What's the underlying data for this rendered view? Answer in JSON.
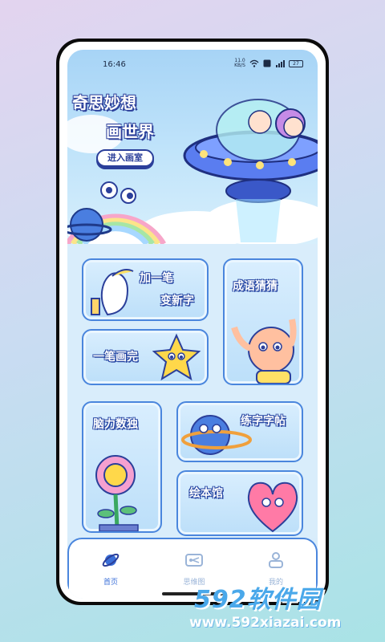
{
  "status_bar": {
    "time": "16:46",
    "speed_value": "11.0",
    "speed_unit": "KB/S",
    "battery": "27"
  },
  "hero": {
    "title_line1": "奇思妙想",
    "title_line2": "画世界",
    "enter_button": "进入画室"
  },
  "cards": {
    "add_stroke_line1": "加一笔",
    "add_stroke_line2": "变新字",
    "idiom_guess": "成语猜猜",
    "one_stroke": "一笔画完",
    "sudoku": "脑力数独",
    "calligraphy": "练字字帖",
    "picture_book": "绘本馆"
  },
  "bottom_nav": {
    "items": [
      {
        "label": "首页",
        "icon": "planet-icon",
        "active": true
      },
      {
        "label": "思维图",
        "icon": "mindmap-icon",
        "active": false
      },
      {
        "label": "我的",
        "icon": "user-icon",
        "active": false
      }
    ]
  },
  "watermark": {
    "brand": "592软件园",
    "url": "www.592xiazai.com"
  },
  "colors": {
    "accent": "#3b6fd8",
    "card_border": "#4a86dd",
    "title_outline": "#2b3f9a"
  }
}
